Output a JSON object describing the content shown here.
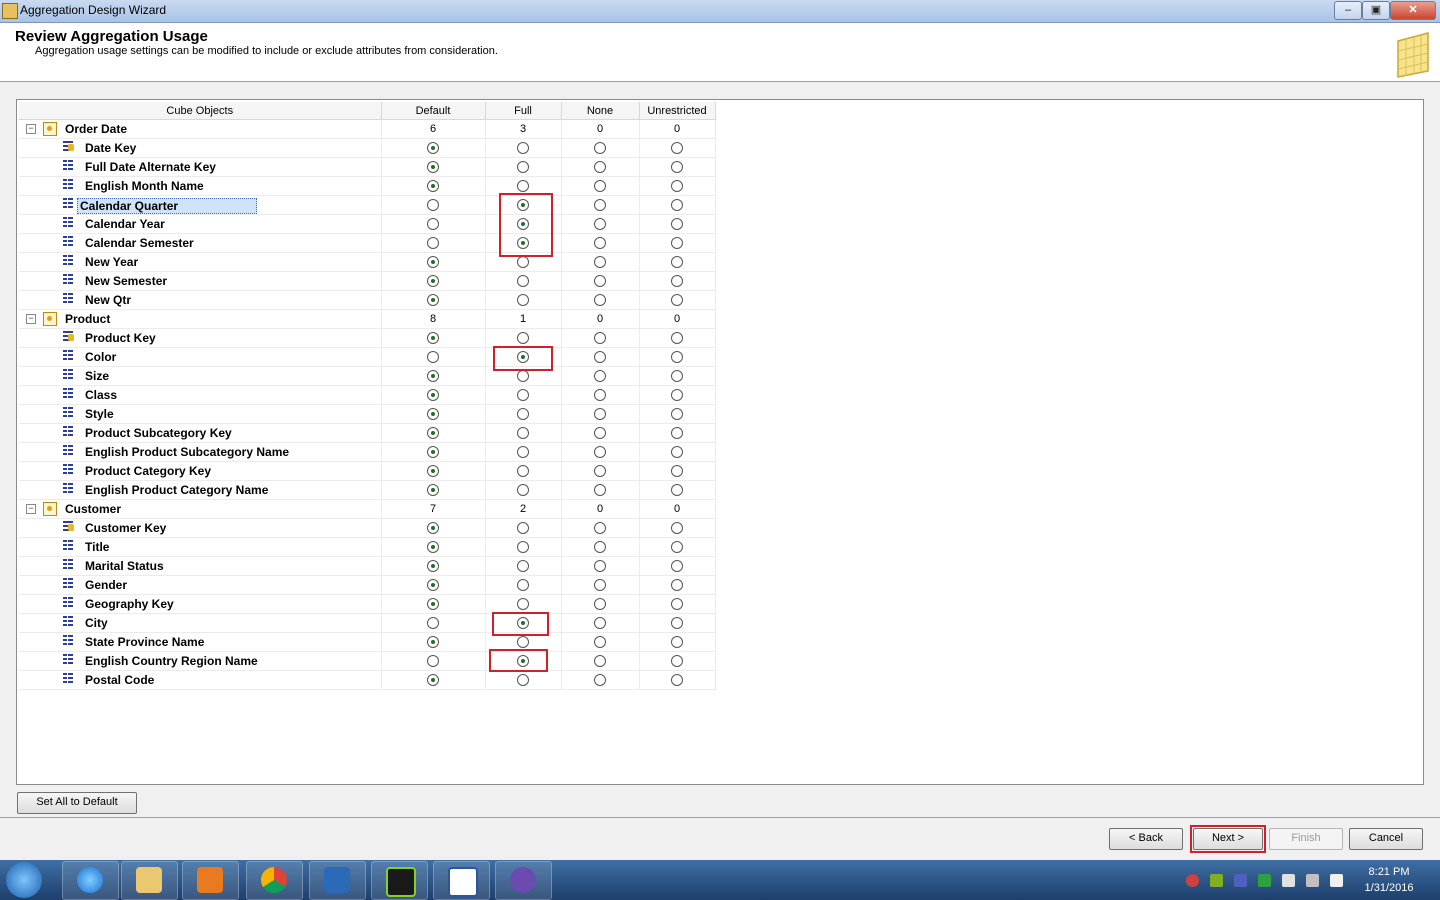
{
  "window": {
    "title": "Aggregation Design Wizard"
  },
  "header": {
    "title": "Review Aggregation Usage",
    "subtitle": "Aggregation usage settings can be modified to include or exclude attributes from consideration."
  },
  "grid": {
    "columns": [
      "Cube Objects",
      "Default",
      "Full",
      "None",
      "Unrestricted"
    ],
    "dimensions": [
      {
        "name": "Order Date",
        "counts": [
          "6",
          "3",
          "0",
          "0"
        ],
        "attributes": [
          {
            "name": "Date Key",
            "key": true,
            "value": "Default"
          },
          {
            "name": "Full Date Alternate Key",
            "value": "Default"
          },
          {
            "name": "English Month Name",
            "value": "Default"
          },
          {
            "name": "Calendar Quarter",
            "value": "Full",
            "selected": true
          },
          {
            "name": "Calendar Year",
            "value": "Full"
          },
          {
            "name": "Calendar Semester",
            "value": "Full"
          },
          {
            "name": "New Year",
            "value": "Default"
          },
          {
            "name": "New Semester",
            "value": "Default"
          },
          {
            "name": "New Qtr",
            "value": "Default"
          }
        ]
      },
      {
        "name": "Product",
        "counts": [
          "8",
          "1",
          "0",
          "0"
        ],
        "attributes": [
          {
            "name": "Product Key",
            "key": true,
            "value": "Default"
          },
          {
            "name": "Color",
            "value": "Full"
          },
          {
            "name": "Size",
            "value": "Default"
          },
          {
            "name": "Class",
            "value": "Default"
          },
          {
            "name": "Style",
            "value": "Default"
          },
          {
            "name": "Product Subcategory Key",
            "value": "Default"
          },
          {
            "name": "English Product Subcategory Name",
            "value": "Default"
          },
          {
            "name": "Product Category Key",
            "value": "Default"
          },
          {
            "name": "English Product Category Name",
            "value": "Default"
          }
        ]
      },
      {
        "name": "Customer",
        "counts": [
          "7",
          "2",
          "0",
          "0"
        ],
        "attributes": [
          {
            "name": "Customer Key",
            "key": true,
            "value": "Default"
          },
          {
            "name": "Title",
            "value": "Default"
          },
          {
            "name": "Marital Status",
            "value": "Default"
          },
          {
            "name": "Gender",
            "value": "Default"
          },
          {
            "name": "Geography Key",
            "value": "Default"
          },
          {
            "name": "City",
            "value": "Full"
          },
          {
            "name": "State Province Name",
            "value": "Default"
          },
          {
            "name": "English Country Region Name",
            "value": "Full"
          },
          {
            "name": "Postal Code",
            "value": "Default"
          }
        ]
      }
    ]
  },
  "buttons": {
    "set_all_default": "Set All to Default",
    "back": "< Back",
    "next": "Next >",
    "finish": "Finish",
    "cancel": "Cancel"
  },
  "taskbar": {
    "apps": [
      "start-orb",
      "internet-explorer-icon",
      "file-explorer-icon",
      "media-player-icon",
      "chrome-icon",
      "lync-icon",
      "sql-dev-icon",
      "word-icon",
      "visual-studio-icon"
    ],
    "time": "8:21 PM",
    "date": "1/31/2016"
  },
  "colors": {
    "highlight_box": "#d0202a",
    "selected_row": "#cfe3fb",
    "taskbar": "#2a5288"
  }
}
